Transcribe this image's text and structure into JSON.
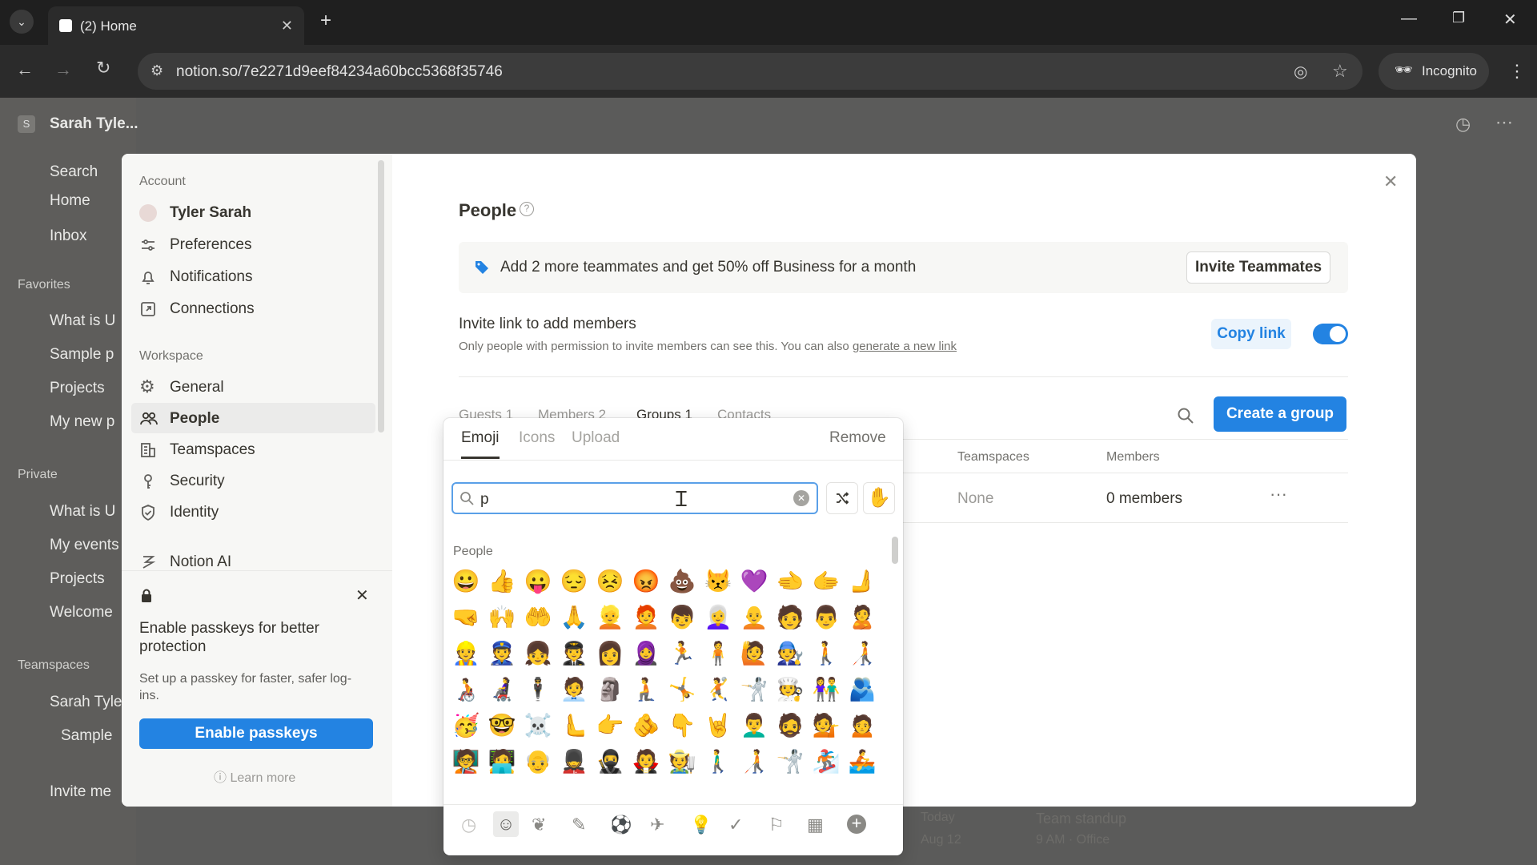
{
  "browser": {
    "tab_title": "(2) Home",
    "url": "notion.so/7e2271d9eef84234a60bcc5368f35746",
    "incognito_label": "Incognito"
  },
  "notion": {
    "workspace_name": "Sarah Tyle...",
    "search": "Search",
    "home": "Home",
    "inbox": "Inbox",
    "favorites_header": "Favorites",
    "favorites": [
      "What is U",
      "Sample p",
      "Projects",
      "My new p"
    ],
    "private_header": "Private",
    "private": [
      "What is U",
      "My events",
      "Projects",
      "Welcome"
    ],
    "teamspaces_header": "Teamspaces",
    "teamspaces": [
      "Sarah Tyle",
      "Sample"
    ],
    "invite": "Invite me",
    "bg_text": [
      "Today",
      "Aug 12",
      "Team standup",
      "9 AM · Office"
    ]
  },
  "settings": {
    "account_header": "Account",
    "account_items": [
      "Tyler Sarah",
      "Preferences",
      "Notifications",
      "Connections"
    ],
    "workspace_header": "Workspace",
    "workspace_items": [
      "General",
      "People",
      "Teamspaces",
      "Security",
      "Identity"
    ],
    "notion_ai": "Notion AI",
    "passkey": {
      "title": "Enable passkeys for better protection",
      "desc": "Set up a passkey for faster, safer log-ins.",
      "button": "Enable passkeys",
      "learn_more": "Learn more"
    }
  },
  "people": {
    "title": "People",
    "promo_text": "Add 2 more teammates and get 50% off Business for a month",
    "invite_button": "Invite Teammates",
    "invite_link_title": "Invite link to add members",
    "invite_link_desc": "Only people with permission to invite members can see this. You can also",
    "generate_link": "generate a new link",
    "copy_link": "Copy link",
    "tabs": [
      "Guests 1",
      "Members 2",
      "Groups 1",
      "Contacts"
    ],
    "create_group": "Create a group",
    "columns": [
      "Teamspaces",
      "Members"
    ],
    "row": {
      "teamspaces": "None",
      "members": "0 members"
    }
  },
  "picker": {
    "tabs": [
      "Emoji",
      "Icons",
      "Upload"
    ],
    "remove": "Remove",
    "search_value": "p",
    "section": "People",
    "emojis": [
      "😀",
      "👍",
      "😛",
      "😔",
      "😣",
      "😡",
      "💩",
      "😾",
      "💜",
      "🫲",
      "🫱",
      "🫸",
      "🤜",
      "🙌",
      "🤲",
      "🙏",
      "👱",
      "🧑‍🦰",
      "👦",
      "👩‍🦳",
      "🧑‍🦲",
      "🧑",
      "👨",
      "🙎",
      "👷",
      "👮",
      "👧",
      "🧑‍✈️",
      "👩",
      "🧕",
      "🏃",
      "🧍",
      "🙋",
      "🧑‍🔧",
      "🚶",
      "🧑‍🦯",
      "🧑‍🦽",
      "👩‍🦼",
      "🕴",
      "🧑‍💼",
      "🗿",
      "🧎",
      "🤸",
      "🤾",
      "🤺",
      "🧑‍🍳",
      "👫",
      "🫂",
      "🥳",
      "🤓",
      "☠️",
      "🫷",
      "👉",
      "🫵",
      "👇",
      "🤘",
      "👨‍🦱",
      "🧔",
      "💁",
      "🙍",
      "🧑‍🏫",
      "🧑‍💻",
      "👴",
      "💂",
      "🥷",
      "🧛",
      "🧑‍🌾",
      "🚶‍♂️",
      "🧑‍🦯",
      "🤺",
      "🏂",
      "🚣"
    ]
  },
  "colors": {
    "accent": "#2383e2",
    "toggle": "#2383e2"
  }
}
